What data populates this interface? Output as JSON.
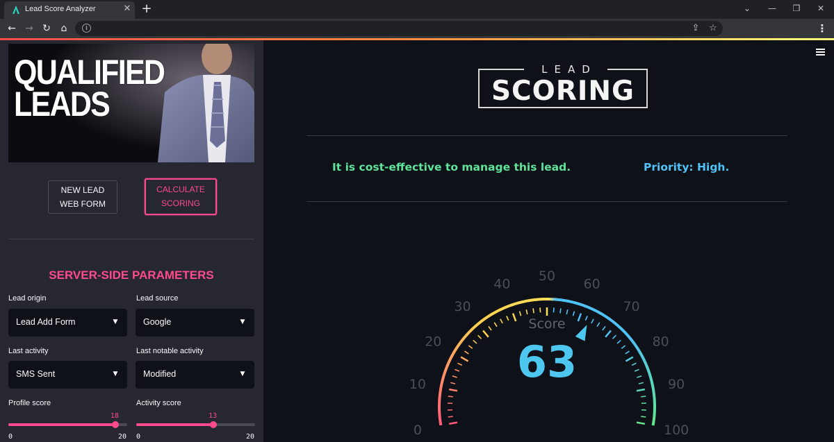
{
  "browser": {
    "tab_title": "Lead Score Analyzer",
    "tab_close": "✕",
    "new_tab": "+",
    "window_controls": {
      "minimize": "—",
      "restore": "❐",
      "close": "✕",
      "tabs_menu": "⌄"
    },
    "nav": {
      "back": "←",
      "forward": "→",
      "reload": "↻",
      "home": "⌂"
    },
    "omnibox_info": "i",
    "omnibox_share": "⇪",
    "omnibox_star": "☆",
    "menu": "⋮"
  },
  "sidebar": {
    "hero_text": "QUALIFIED\nLEADS",
    "buttons": {
      "new_lead": "NEW LEAD\nWEB FORM",
      "calculate": "CALCULATE\nSCORING"
    },
    "section_title": "SERVER-SIDE PARAMETERS",
    "fields": {
      "lead_origin": {
        "label": "Lead origin",
        "value": "Lead Add Form"
      },
      "lead_source": {
        "label": "Lead source",
        "value": "Google"
      },
      "last_activity": {
        "label": "Last activity",
        "value": "SMS Sent"
      },
      "last_notable_activity": {
        "label": "Last notable activity",
        "value": "Modified"
      }
    },
    "caret": "▼",
    "sliders": {
      "profile_score": {
        "label": "Profile score",
        "value": 18,
        "min": "0",
        "max": "20"
      },
      "activity_score": {
        "label": "Activity score",
        "value": 13,
        "min": "0",
        "max": "20"
      }
    }
  },
  "main": {
    "logo": {
      "top": "LEAD",
      "main": "SCORING"
    },
    "message": "It is cost-effective to manage this lead.",
    "priority": "Priority: High.",
    "gauge": {
      "label": "Score",
      "value": 63,
      "min": 0,
      "max": 100,
      "tick_labels": [
        "0",
        "10",
        "20",
        "30",
        "40",
        "50",
        "60",
        "70",
        "80",
        "90",
        "100"
      ]
    }
  },
  "colors": {
    "accent": "#ff4b8b",
    "message_green": "#5fe39b",
    "priority_blue": "#4fc3f7",
    "gauge_value": "#4dc7ef"
  }
}
